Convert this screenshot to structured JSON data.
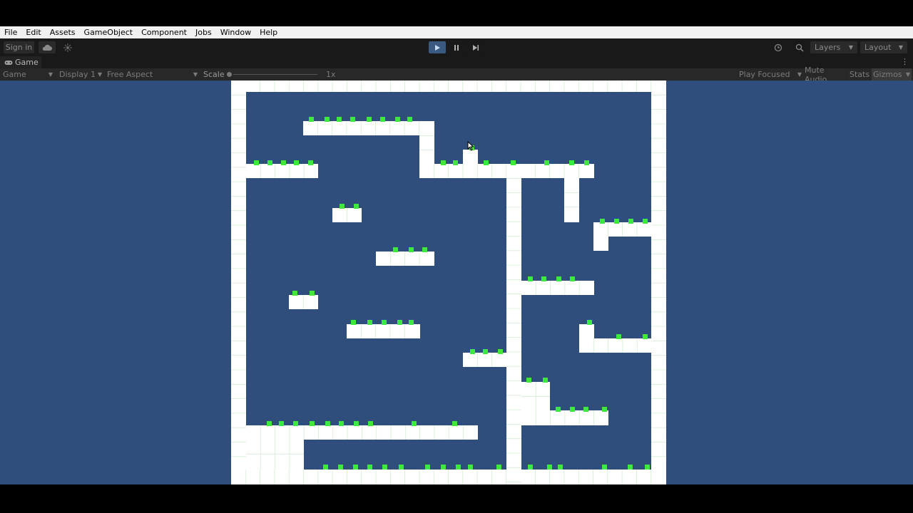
{
  "menu": [
    "File",
    "Edit",
    "Assets",
    "GameObject",
    "Component",
    "Jobs",
    "Window",
    "Help"
  ],
  "toolbar": {
    "sign_in": "Sign in",
    "layers": "Layers",
    "layout": "Layout",
    "play_icon": "play-icon",
    "pause_icon": "pause-icon",
    "step_icon": "step-icon"
  },
  "tab": {
    "label": "Game"
  },
  "gamebar": {
    "mode": "Game",
    "display": "Display 1",
    "aspect": "Free Aspect",
    "scale_label": "Scale",
    "scale_value": "1x",
    "play_focused": "Play Focused",
    "mute_audio": "Mute Audio",
    "stats": "Stats",
    "gizmos": "Gizmos"
  },
  "colors": {
    "background": "#2f4e7c",
    "block": "#ffffff",
    "block_grid": "#d6ecd6",
    "pickup": "#3fe83f"
  }
}
